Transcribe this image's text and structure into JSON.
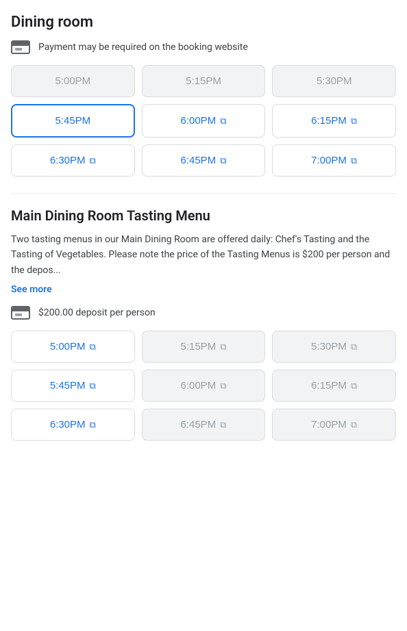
{
  "section1": {
    "title": "Dining room",
    "payment_notice": "Payment may be required on the booking website",
    "time_slots": [
      {
        "label": "5:00PM",
        "state": "disabled",
        "external": false
      },
      {
        "label": "5:15PM",
        "state": "disabled",
        "external": false
      },
      {
        "label": "5:30PM",
        "state": "disabled",
        "external": false
      },
      {
        "label": "5:45PM",
        "state": "selected",
        "external": false
      },
      {
        "label": "6:00PM",
        "state": "active",
        "external": true
      },
      {
        "label": "6:15PM",
        "state": "active",
        "external": true
      },
      {
        "label": "6:30PM",
        "state": "active",
        "external": true
      },
      {
        "label": "6:45PM",
        "state": "active",
        "external": true
      },
      {
        "label": "7:00PM",
        "state": "active",
        "external": true
      }
    ]
  },
  "section2": {
    "title": "Main Dining Room Tasting Menu",
    "description": "Two tasting menus in our Main Dining Room are offered daily: Chef's Tasting and the Tasting of Vegetables. Please note the price of the Tasting Menus is $200 per person and the depos...",
    "see_more_label": "See more",
    "deposit_notice": "$200.00 deposit per person",
    "time_slots": [
      {
        "label": "5:00PM",
        "state": "active",
        "external": true
      },
      {
        "label": "5:15PM",
        "state": "disabled",
        "external": true
      },
      {
        "label": "5:30PM",
        "state": "disabled",
        "external": true
      },
      {
        "label": "5:45PM",
        "state": "active",
        "external": true
      },
      {
        "label": "6:00PM",
        "state": "disabled",
        "external": true
      },
      {
        "label": "6:15PM",
        "state": "disabled",
        "external": true
      },
      {
        "label": "6:30PM",
        "state": "active",
        "external": true
      },
      {
        "label": "6:45PM",
        "state": "disabled",
        "external": true
      },
      {
        "label": "7:00PM",
        "state": "disabled",
        "external": true
      }
    ]
  },
  "icons": {
    "external_link": "⧉",
    "external_link_alt": "↗"
  }
}
